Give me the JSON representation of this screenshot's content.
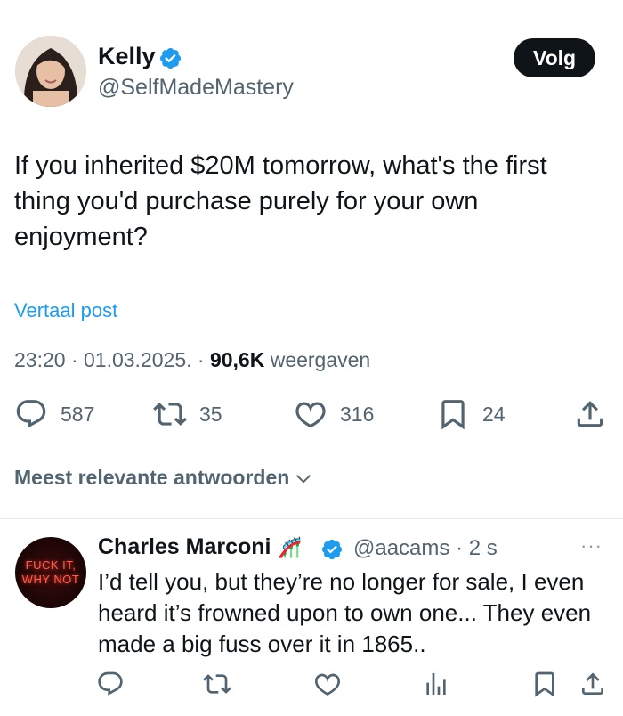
{
  "post": {
    "author": {
      "name": "Kelly",
      "handle": "@SelfMadeMastery",
      "verified_color": "#1d9bf0"
    },
    "follow_label": "Volg",
    "text": "If you inherited $20M tomorrow, what's the first thing you'd purchase purely for your own enjoyment?",
    "translate_label": "Vertaal post",
    "time": "23:20 · 01.03.2025. · ",
    "views_count": "90,6K",
    "views_label": " weergaven",
    "stats": {
      "replies": "587",
      "reposts": "35",
      "likes": "316",
      "bookmarks": "24"
    }
  },
  "sort_label": "Meest relevante antwoorden",
  "reply": {
    "avatar_text_line1": "FUCK IT,",
    "avatar_text_line2": "WHY NOT",
    "author_name": "Charles Marconi",
    "author_emoji": "🎢",
    "handle_time": "@aacams · 2 s",
    "more_label": "···",
    "text": "I’d tell you, but they’re no longer for sale, I even heard it’s frowned upon to own one... They even made a big fuss over it in 1865.."
  },
  "icons": {
    "reply": "speech-bubble-icon",
    "repost": "repost-arrows-icon",
    "like": "heart-icon",
    "bookmark": "bookmark-icon",
    "share": "share-upload-icon",
    "views": "analytics-bars-icon"
  }
}
